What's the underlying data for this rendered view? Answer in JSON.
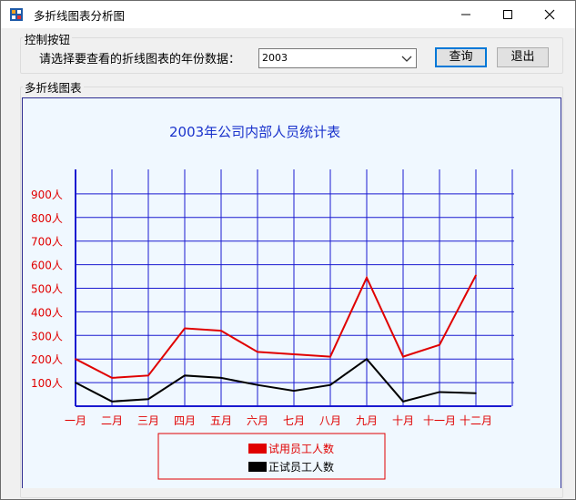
{
  "window": {
    "title": "多折线图表分析图",
    "min_icon": "minimize-icon",
    "max_icon": "maximize-icon",
    "close_icon": "close-icon"
  },
  "controls": {
    "group_title": "控制按钮",
    "prompt": "请选择要查看的折线图表的年份数据：",
    "year_value": "2003",
    "query_label": "查询",
    "exit_label": "退出"
  },
  "chart_group": {
    "title": "多折线图表"
  },
  "colors": {
    "grid": "#1a1ad0",
    "trial": "#e00000",
    "regular": "#000000",
    "axis_text": "#e00000",
    "title": "#1a33cc"
  },
  "chart_data": {
    "type": "line",
    "title": "2003年公司内部人员统计表",
    "categories": [
      "一月",
      "二月",
      "三月",
      "四月",
      "五月",
      "六月",
      "七月",
      "八月",
      "九月",
      "十月",
      "十一月",
      "十二月"
    ],
    "y_ticks": [
      "100人",
      "200人",
      "300人",
      "400人",
      "500人",
      "600人",
      "700人",
      "800人",
      "900人"
    ],
    "ylim": [
      0,
      1000
    ],
    "series": [
      {
        "name": "试用员工人数",
        "color": "#e00000",
        "values": [
          200,
          120,
          130,
          330,
          320,
          230,
          220,
          210,
          545,
          210,
          260,
          555
        ]
      },
      {
        "name": "正试员工人数",
        "color": "#000000",
        "values": [
          100,
          20,
          30,
          130,
          120,
          90,
          65,
          90,
          200,
          20,
          60,
          55
        ]
      }
    ],
    "grid": true,
    "legend_position": "bottom"
  }
}
